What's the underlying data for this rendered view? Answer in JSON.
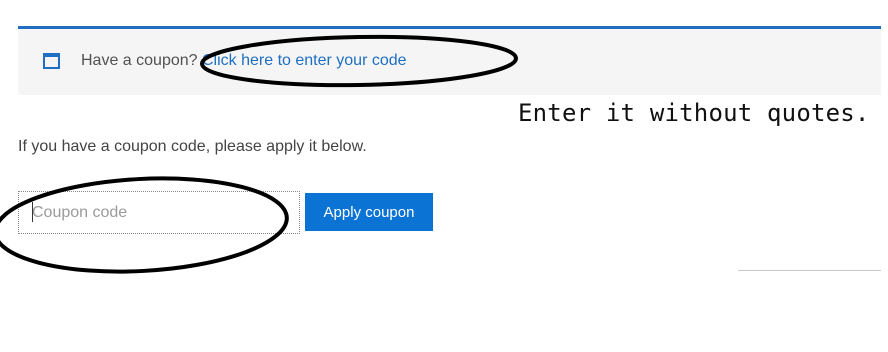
{
  "notice": {
    "icon": "window-icon",
    "prefix": "Have a coupon? ",
    "link_label": "Click here to enter your code",
    "accent_color": "#1e6fc1"
  },
  "annotation": {
    "text": "Enter it without quotes."
  },
  "coupon_form": {
    "instruction": "If you have a coupon code, please apply it below.",
    "input_value": "",
    "input_placeholder": "Coupon code",
    "apply_label": "Apply coupon",
    "button_color": "#0a73d4"
  }
}
